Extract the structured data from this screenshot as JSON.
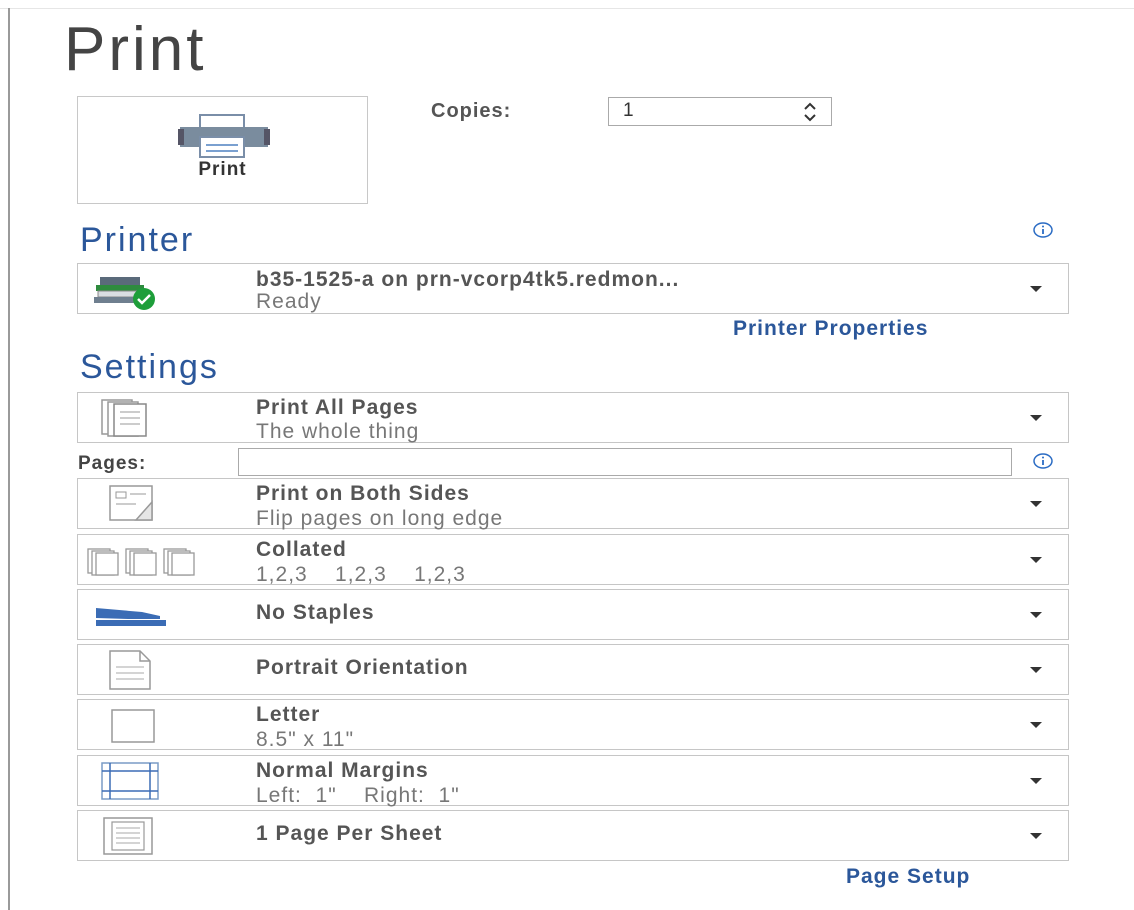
{
  "title": "Print",
  "print_button": {
    "label": "Print",
    "icon": "printer-icon"
  },
  "copies": {
    "label": "Copies:",
    "value": "1"
  },
  "printer_section": {
    "title": "Printer",
    "selected": {
      "name": "b35-1525-a on prn-vcorp4tk5.redmon...",
      "status": "Ready",
      "icon": "printer-ready-icon"
    },
    "properties_link": "Printer Properties"
  },
  "settings_section": {
    "title": "Settings",
    "pages_label": "Pages:",
    "pages_value": "",
    "items": [
      {
        "line1": "Print All Pages",
        "line2": "The whole thing",
        "icon": "pages-stack-icon"
      },
      {
        "line1": "Print on Both Sides",
        "line2": "Flip pages on long edge",
        "icon": "duplex-icon"
      },
      {
        "line1": "Collated",
        "line2": "1,2,3    1,2,3    1,2,3",
        "icon": "collated-icon"
      },
      {
        "line1": "No Staples",
        "line2": "",
        "icon": "stapler-icon"
      },
      {
        "line1": "Portrait Orientation",
        "line2": "",
        "icon": "portrait-page-icon"
      },
      {
        "line1": "Letter",
        "line2": "8.5\" x 11\"",
        "icon": "paper-size-icon"
      },
      {
        "line1": "Normal Margins",
        "line2": "Left:  1\"    Right:  1\"",
        "icon": "margins-icon"
      },
      {
        "line1": "1 Page Per Sheet",
        "line2": "",
        "icon": "pages-per-sheet-icon"
      }
    ],
    "page_setup_link": "Page Setup"
  },
  "colors": {
    "accent": "#2b579a",
    "ready_badge": "#1e9e3a"
  }
}
